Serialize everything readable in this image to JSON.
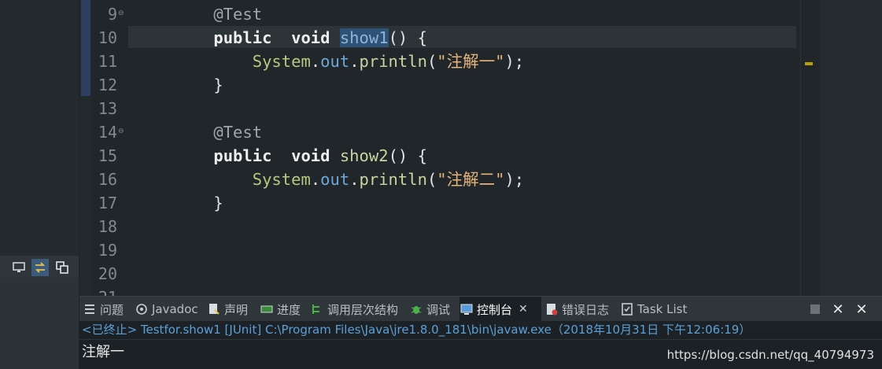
{
  "editor": {
    "lines": [
      {
        "num": "9",
        "fold": true,
        "tokens": [
          {
            "t": "    ",
            "c": ""
          },
          {
            "t": "@Test",
            "c": "ann"
          }
        ]
      },
      {
        "num": "10",
        "fold": false,
        "current": true,
        "tokens": [
          {
            "t": "    ",
            "c": ""
          },
          {
            "t": "public",
            "c": "kw"
          },
          {
            "t": "  ",
            "c": ""
          },
          {
            "t": "void",
            "c": "kw"
          },
          {
            "t": " ",
            "c": ""
          },
          {
            "t": "show1",
            "c": "occ"
          },
          {
            "t": "() {",
            "c": ""
          }
        ]
      },
      {
        "num": "11",
        "fold": false,
        "tokens": [
          {
            "t": "        ",
            "c": ""
          },
          {
            "t": "System",
            "c": "cls"
          },
          {
            "t": ".",
            "c": ""
          },
          {
            "t": "out",
            "c": "fld"
          },
          {
            "t": ".",
            "c": ""
          },
          {
            "t": "println",
            "c": "fn"
          },
          {
            "t": "(",
            "c": ""
          },
          {
            "t": "\"注解一\"",
            "c": "str"
          },
          {
            "t": ");",
            "c": ""
          }
        ]
      },
      {
        "num": "12",
        "fold": false,
        "tokens": [
          {
            "t": "    }",
            "c": ""
          }
        ]
      },
      {
        "num": "13",
        "fold": false,
        "tokens": []
      },
      {
        "num": "14",
        "fold": true,
        "tokens": [
          {
            "t": "    ",
            "c": ""
          },
          {
            "t": "@Test",
            "c": "ann"
          }
        ]
      },
      {
        "num": "15",
        "fold": false,
        "tokens": [
          {
            "t": "    ",
            "c": ""
          },
          {
            "t": "public",
            "c": "kw"
          },
          {
            "t": "  ",
            "c": ""
          },
          {
            "t": "void",
            "c": "kw"
          },
          {
            "t": " ",
            "c": ""
          },
          {
            "t": "show2",
            "c": "fn"
          },
          {
            "t": "() {",
            "c": ""
          }
        ]
      },
      {
        "num": "16",
        "fold": false,
        "tokens": [
          {
            "t": "        ",
            "c": ""
          },
          {
            "t": "System",
            "c": "cls"
          },
          {
            "t": ".",
            "c": ""
          },
          {
            "t": "out",
            "c": "fld"
          },
          {
            "t": ".",
            "c": ""
          },
          {
            "t": "println",
            "c": "fn"
          },
          {
            "t": "(",
            "c": ""
          },
          {
            "t": "\"注解二\"",
            "c": "str"
          },
          {
            "t": ");",
            "c": ""
          }
        ]
      },
      {
        "num": "17",
        "fold": false,
        "tokens": [
          {
            "t": "    }",
            "c": ""
          }
        ]
      },
      {
        "num": "18",
        "fold": false,
        "tokens": []
      },
      {
        "num": "19",
        "fold": false,
        "tokens": []
      },
      {
        "num": "20",
        "fold": false,
        "tokens": []
      },
      {
        "num": "21",
        "fold": false,
        "tokens": []
      }
    ]
  },
  "tabs": [
    {
      "label": "问题",
      "icon": "problems-icon"
    },
    {
      "label": "Javadoc",
      "icon": "javadoc-icon"
    },
    {
      "label": "声明",
      "icon": "declaration-icon"
    },
    {
      "label": "进度",
      "icon": "progress-icon"
    },
    {
      "label": "调用层次结构",
      "icon": "call-hierarchy-icon"
    },
    {
      "label": "调试",
      "icon": "debug-icon"
    },
    {
      "label": "控制台",
      "icon": "console-icon",
      "active": true,
      "close": "✕"
    },
    {
      "label": "错误日志",
      "icon": "error-log-icon"
    },
    {
      "label": "Task List",
      "icon": "task-list-icon"
    }
  ],
  "console": {
    "status": "<已终止> Testfor.show1 [JUnit] C:\\Program Files\\Java\\jre1.8.0_181\\bin\\javaw.exe（2018年10月31日 下午12:06:19）",
    "output": "注解一",
    "watermark": "https://blog.csdn.net/qq_40794973"
  },
  "colors": {
    "editor_bg": "#20262a",
    "keyword": "#eeeeee",
    "string": "#e6b47a",
    "class": "#b6c97c",
    "field": "#6ea8d8",
    "status_link": "#5aa0d8"
  }
}
